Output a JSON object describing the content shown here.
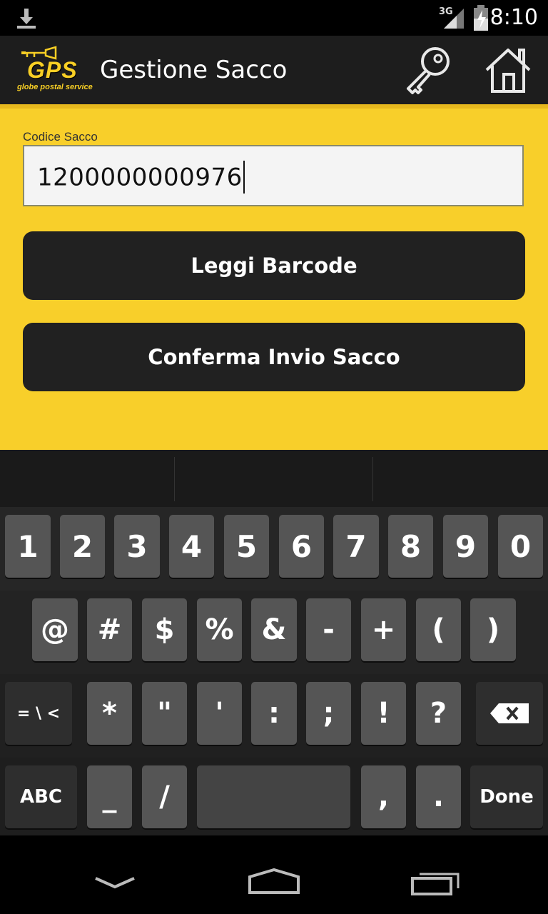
{
  "status_bar": {
    "time": "8:10",
    "network": "3G"
  },
  "action_bar": {
    "logo_text": "GPS",
    "logo_subtext": "globe postal service",
    "title": "Gestione Sacco"
  },
  "form": {
    "code_label": "Codice Sacco",
    "code_value": "1200000000976",
    "read_barcode_label": "Leggi Barcode",
    "confirm_label": "Conferma Invio Sacco"
  },
  "keyboard": {
    "row1": [
      "1",
      "2",
      "3",
      "4",
      "5",
      "6",
      "7",
      "8",
      "9",
      "0"
    ],
    "row2": [
      "@",
      "#",
      "$",
      "%",
      "&",
      "-",
      "+",
      "(",
      ")"
    ],
    "row3": [
      "= \\ <",
      "*",
      "\"",
      "'",
      ":",
      ";",
      "!",
      "?"
    ],
    "row4": [
      "ABC",
      "_",
      "/",
      ",",
      ".",
      "Done"
    ]
  },
  "colors": {
    "accent_yellow": "#f8cf2a",
    "button_dark": "#212121",
    "key_gray": "#555555"
  }
}
